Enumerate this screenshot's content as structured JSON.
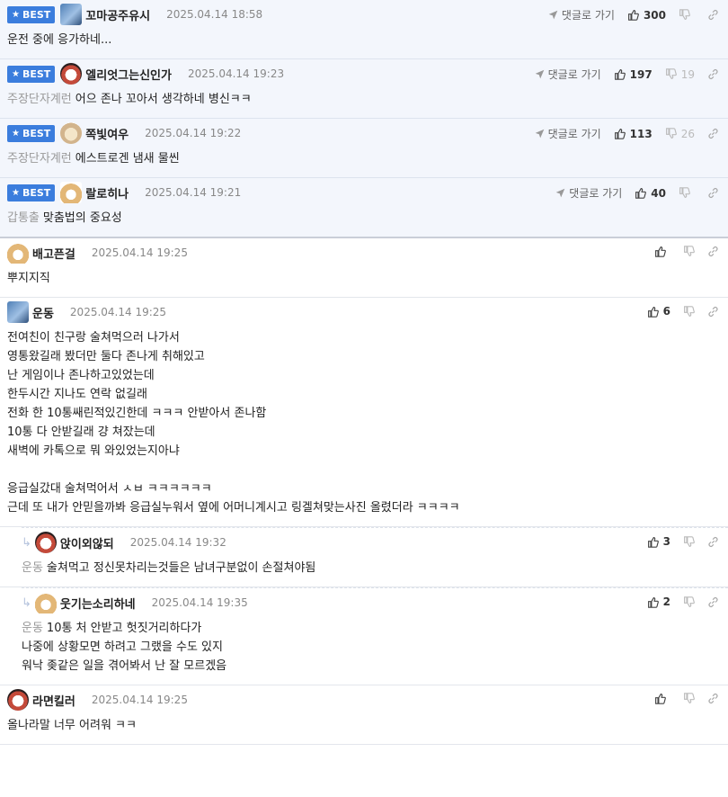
{
  "labels": {
    "best": "BEST",
    "reply_link": "댓글로 가기"
  },
  "best_comments": [
    {
      "nick": "꼬마공주유시",
      "date": "2025.04.14 18:58",
      "tag": "",
      "text": "운전 중에 응가하네...",
      "up": "300",
      "down": "",
      "avatar": "av-blue"
    },
    {
      "nick": "엘리엇그는신인가",
      "date": "2025.04.14 19:23",
      "tag": "주장단자계런",
      "text": "어으 존나 꼬아서 생각하네 병신ㅋㅋ",
      "up": "197",
      "down": "19",
      "avatar": "av-dog1"
    },
    {
      "nick": "쪽빛여우",
      "date": "2025.04.14 19:22",
      "tag": "주장단자계런",
      "text": "에스트로겐 냄새 물씬",
      "up": "113",
      "down": "26",
      "avatar": "av-dog2"
    },
    {
      "nick": "랄로히나",
      "date": "2025.04.14 19:21",
      "tag": "갑통출",
      "text": "맞춤법의 중요성",
      "up": "40",
      "down": "",
      "avatar": "av-chi"
    }
  ],
  "comments": [
    {
      "nick": "배고픈걸",
      "date": "2025.04.14 19:25",
      "tag": "",
      "lines": [
        "뿌지지직"
      ],
      "up": "",
      "avatar": "av-chi",
      "reply": false
    },
    {
      "nick": "운동",
      "date": "2025.04.14 19:25",
      "tag": "",
      "lines": [
        "전여친이 친구랑 술쳐먹으러 나가서",
        "영통왔길래 봤더만 둘다 존나게 취해있고",
        "난 게임이나 존나하고있었는데",
        "한두시간 지나도 연락 없길래",
        "전화 한 10통쌔린적있긴한데 ㅋㅋㅋ 안받아서 존나함",
        "10통 다 안받길래 걍 쳐잤는데",
        "새벽에 카톡으로 뭐 와있었는지아냐",
        "",
        "응급실갔대 술쳐먹어서 ㅅㅂ ㅋㅋㅋㅋㅋㅋ",
        "근데 또 내가 안믿을까봐 응급실누워서 옆에 어머니계시고 링겔쳐맞는사진 올렸더라 ㅋㅋㅋㅋ"
      ],
      "up": "6",
      "avatar": "av-blue",
      "reply": false
    },
    {
      "nick": "앉이외않되",
      "date": "2025.04.14 19:32",
      "tag": "운동",
      "lines": [
        "술쳐먹고 정신못차리는것들은 남녀구분없이 손절쳐야됨"
      ],
      "up": "3",
      "avatar": "av-dog1",
      "reply": true
    },
    {
      "nick": "웃기는소리하네",
      "date": "2025.04.14 19:35",
      "tag": "운동",
      "lines": [
        "10통 처 안받고 헛짓거리하다가",
        "나중에 상황모면 하려고 그랬을 수도 있지",
        "워낙 좆같은 일을 겪어봐서 난 잘 모르겠음"
      ],
      "up": "2",
      "avatar": "av-chi",
      "reply": true
    },
    {
      "nick": "라면킬러",
      "date": "2025.04.14 19:25",
      "tag": "",
      "lines": [
        "올나라말 너무 어려워 ㅋㅋ"
      ],
      "up": "",
      "avatar": "av-dog1",
      "reply": false
    }
  ]
}
